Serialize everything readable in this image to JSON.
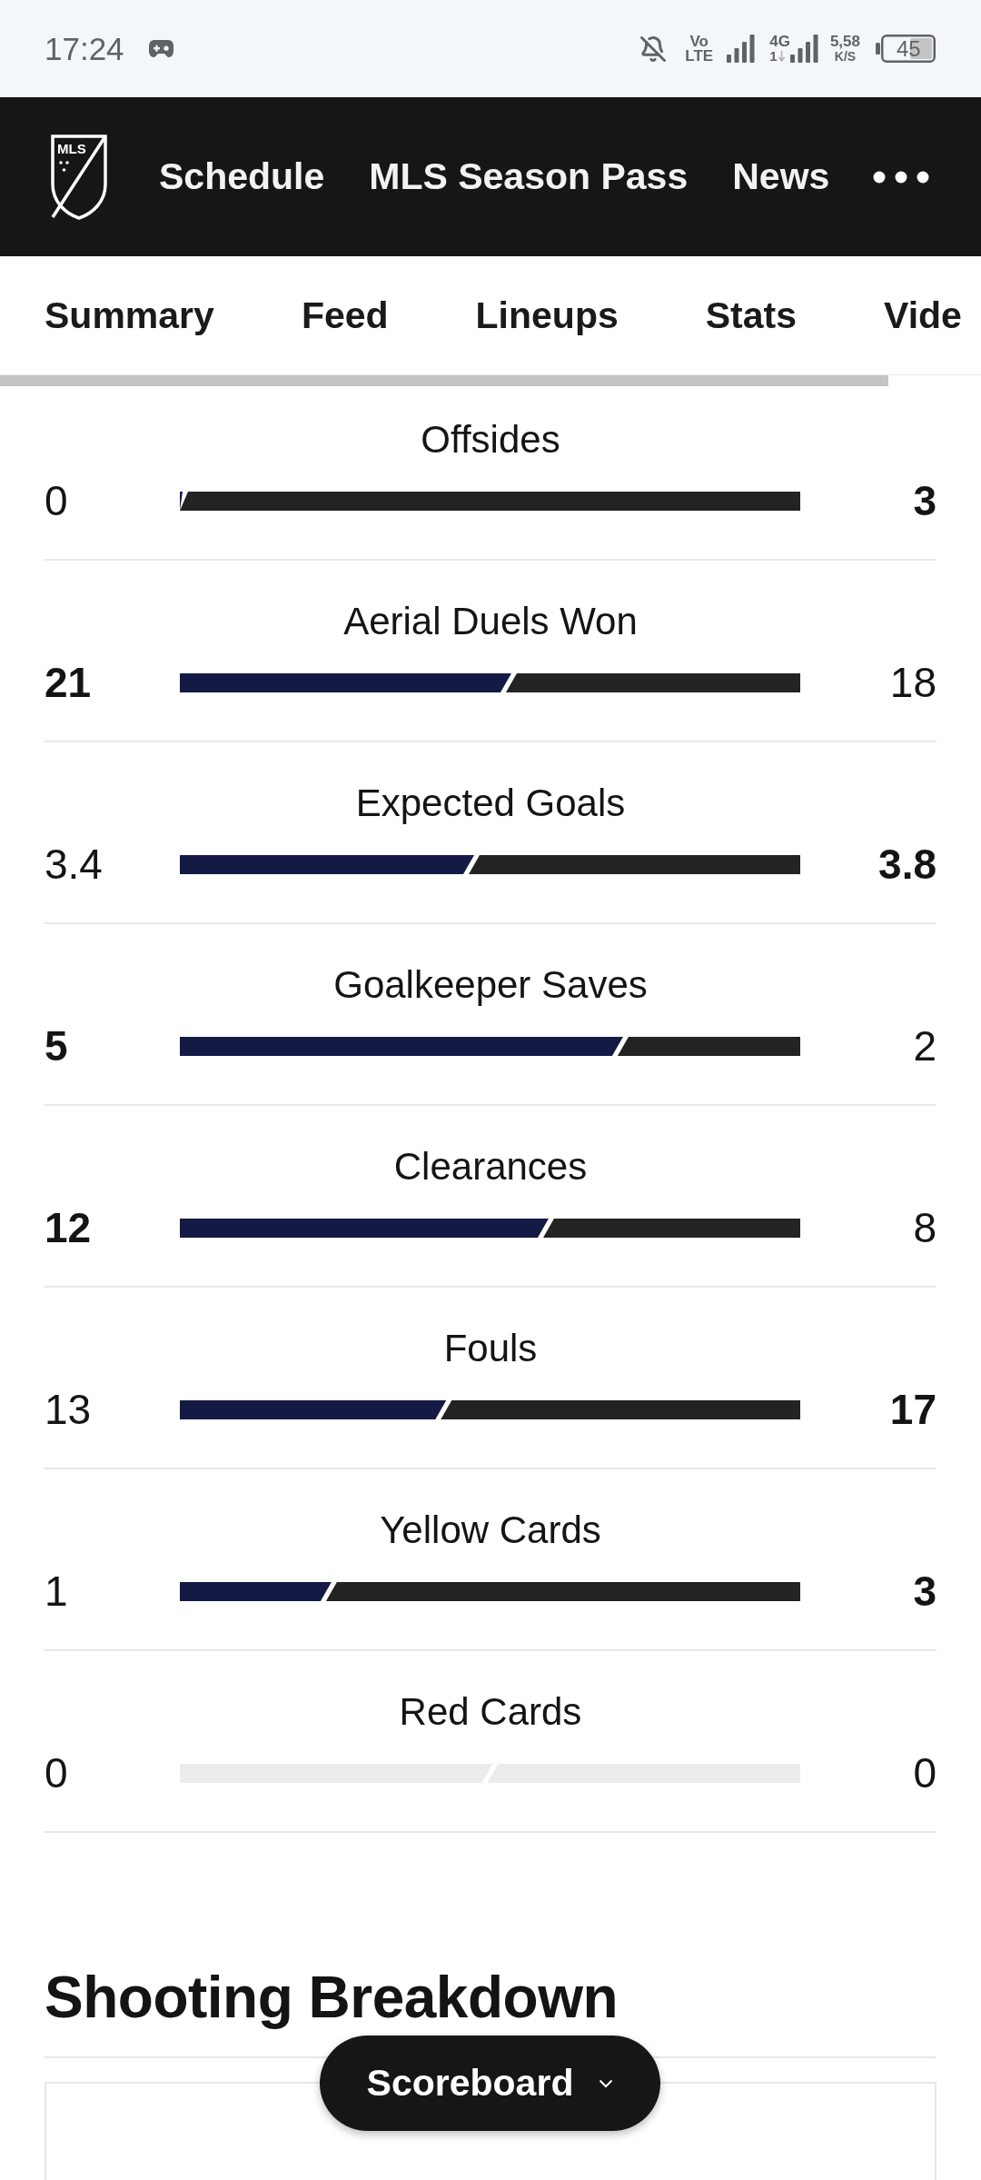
{
  "status_bar": {
    "time": "17:24",
    "volte_top": "Vo",
    "volte_bottom": "LTE",
    "network": "4G",
    "sim": "1",
    "speed": "5,58",
    "speed_unit": "K/S",
    "battery": "45"
  },
  "header": {
    "logo_text": "MLS",
    "nav": [
      "Schedule",
      "MLS Season Pass",
      "News"
    ]
  },
  "tabs": [
    "Summary",
    "Feed",
    "Lineups",
    "Stats",
    "Vide"
  ],
  "stats": [
    {
      "title": "Offsides",
      "kind": "split",
      "level": 0,
      "home": {
        "value": "0",
        "leading": false
      },
      "away": {
        "value": "3",
        "leading": true
      }
    },
    {
      "title": "Aerial Duels Won",
      "kind": "split",
      "level": 0.53,
      "home": {
        "value": "21",
        "leading": true
      },
      "away": {
        "value": "18",
        "leading": false
      }
    },
    {
      "title": "Expected Goals",
      "kind": "split",
      "level": 0.47,
      "home": {
        "value": "3.4",
        "leading": false
      },
      "away": {
        "value": "3.8",
        "leading": true
      }
    },
    {
      "title": "Goalkeeper Saves",
      "kind": "split",
      "level": 0.71,
      "home": {
        "value": "5",
        "leading": true
      },
      "away": {
        "value": "2",
        "leading": false
      }
    },
    {
      "title": "Clearances",
      "kind": "split",
      "level": 0.59,
      "home": {
        "value": "12",
        "leading": true
      },
      "away": {
        "value": "8",
        "leading": false
      }
    },
    {
      "title": "Fouls",
      "kind": "split",
      "level": 0.425,
      "home": {
        "value": "13",
        "leading": false
      },
      "away": {
        "value": "17",
        "leading": true
      }
    },
    {
      "title": "Yellow Cards",
      "kind": "split",
      "level": 0.24,
      "home": {
        "value": "1",
        "leading": false
      },
      "away": {
        "value": "3",
        "leading": true
      }
    },
    {
      "title": "Red Cards",
      "kind": "empty",
      "level": 0.5,
      "home": {
        "value": "0",
        "leading": false
      },
      "away": {
        "value": "0",
        "leading": false
      }
    }
  ],
  "section": {
    "title": "Shooting Breakdown"
  },
  "floating_button": {
    "label": "Scoreboard"
  }
}
